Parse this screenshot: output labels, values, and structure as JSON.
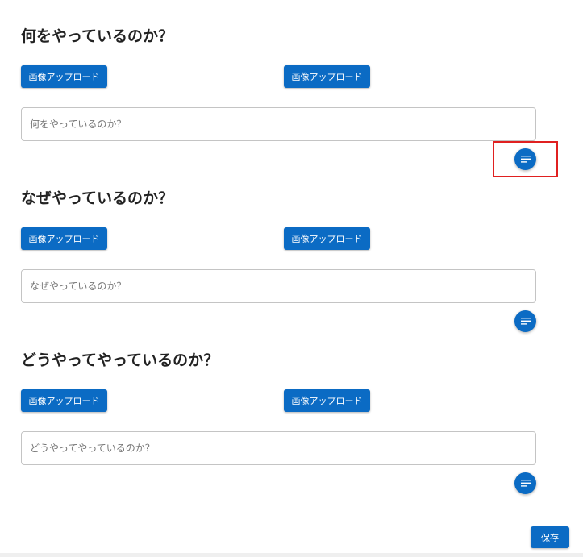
{
  "sections": [
    {
      "title": "何をやっているのか？",
      "upload_left_label": "画像アップロード",
      "upload_right_label": "画像アップロード",
      "input_placeholder": "何をやっているのか？",
      "input_value": ""
    },
    {
      "title": "なぜやっているのか？",
      "upload_left_label": "画像アップロード",
      "upload_right_label": "画像アップロード",
      "input_placeholder": "なぜやっているのか？",
      "input_value": ""
    },
    {
      "title": "どうやってやっているのか？",
      "upload_left_label": "画像アップロード",
      "upload_right_label": "画像アップロード",
      "input_placeholder": "どうやってやっているのか？",
      "input_value": ""
    }
  ],
  "fab_icon": "notes-icon",
  "save_label": "保存",
  "colors": {
    "primary": "#0b6bc4",
    "highlight": "#e02020",
    "border": "#c4c4c4"
  }
}
